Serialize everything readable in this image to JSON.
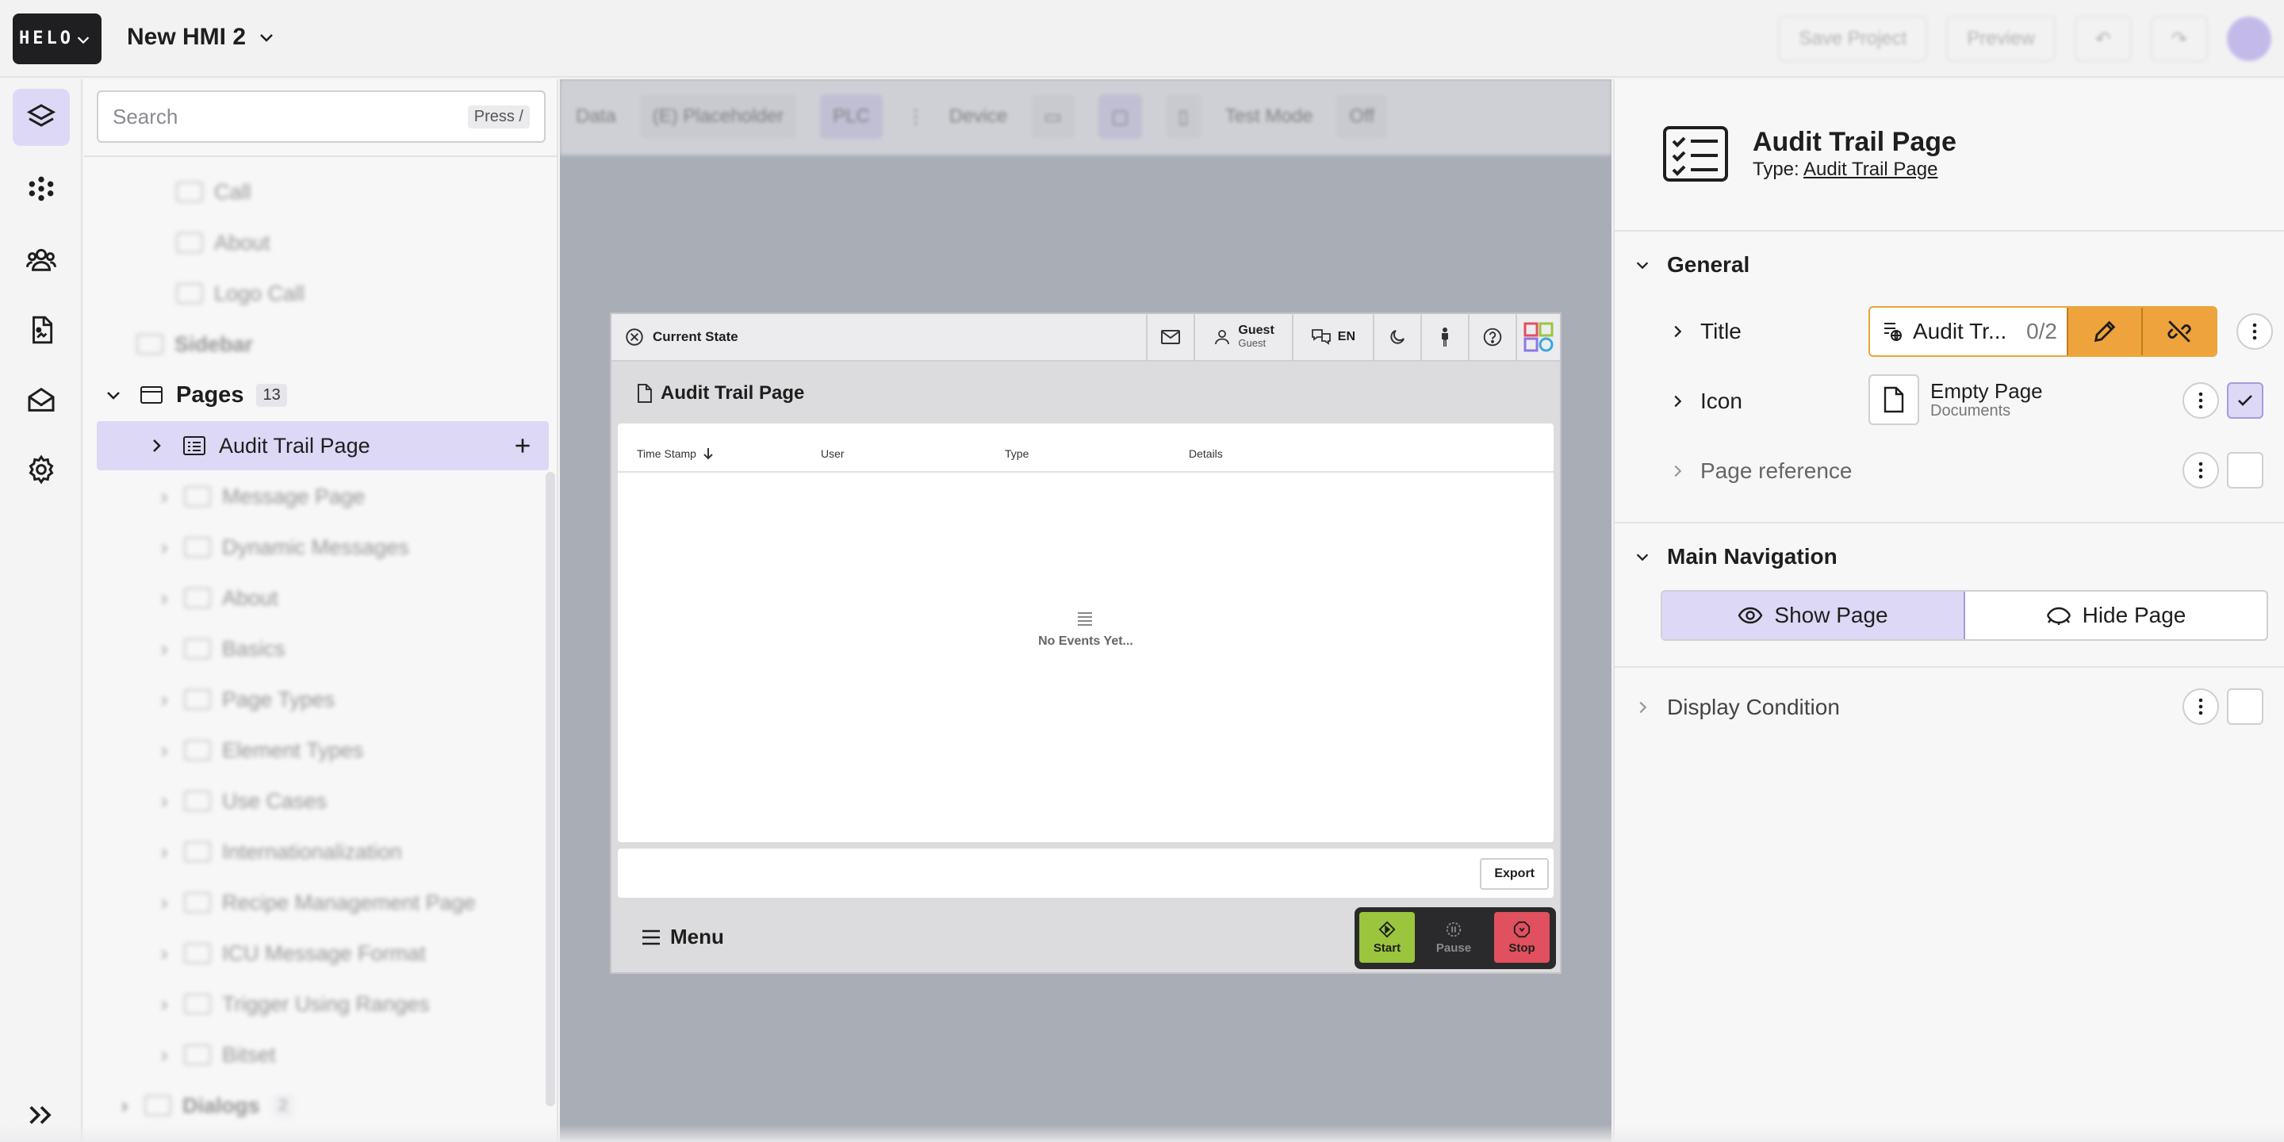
{
  "app": {
    "logo_text": "HELO",
    "project_title": "New HMI 2",
    "top_actions": [
      "Save Project",
      "Preview"
    ]
  },
  "rail": {
    "items": [
      "layers-icon",
      "nodes-icon",
      "users-icon",
      "document-icon",
      "mail-icon",
      "settings-icon",
      "expand-icon"
    ]
  },
  "tree": {
    "search_placeholder": "Search",
    "search_shortcut": "Press /",
    "above_items": [
      "Call",
      "About",
      "Logo Call",
      "Sidebar"
    ],
    "pages_label": "Pages",
    "pages_count": "13",
    "selected_page": "Audit Trail Page",
    "pages": [
      "Message Page",
      "Dynamic Messages",
      "About",
      "Basics",
      "Page Types",
      "Element Types",
      "Use Cases",
      "Internationalization",
      "Recipe Management Page",
      "ICU Message Format",
      "Trigger Using Ranges",
      "Bitset"
    ],
    "dialogs_label": "Dialogs",
    "dialogs_count": "2"
  },
  "canvas_toolbar": {
    "data_label": "Data",
    "placeholder_label": "(E) Placeholder",
    "mode_label": "PLC",
    "device_label": "Device",
    "test_mode_label": "Test Mode",
    "test_mode_value": "Off"
  },
  "hmi": {
    "state_label": "Current State",
    "user_name": "Guest",
    "user_role": "Guest",
    "language": "EN",
    "page_title": "Audit Trail Page",
    "columns": [
      "Time Stamp",
      "User",
      "Type",
      "Details"
    ],
    "empty_text": "No Events Yet...",
    "export_label": "Export",
    "menu_label": "Menu",
    "start_label": "Start",
    "pause_label": "Pause",
    "stop_label": "Stop"
  },
  "props": {
    "title": "Audit Trail Page",
    "type_prefix": "Type:",
    "type_link": "Audit Trail Page",
    "general_label": "General",
    "title_label": "Title",
    "title_value": "Audit Tr...",
    "title_count": "0/2",
    "icon_label": "Icon",
    "icon_name": "Empty Page",
    "icon_category": "Documents",
    "page_reference_label": "Page reference",
    "main_nav_label": "Main Navigation",
    "show_page_label": "Show Page",
    "hide_page_label": "Hide Page",
    "display_condition_label": "Display Condition"
  },
  "colors": {
    "accent_purple": "#ddd8f5",
    "title_orange": "#efa33c",
    "start_green": "#9bc53d",
    "stop_red": "#e0505f"
  }
}
